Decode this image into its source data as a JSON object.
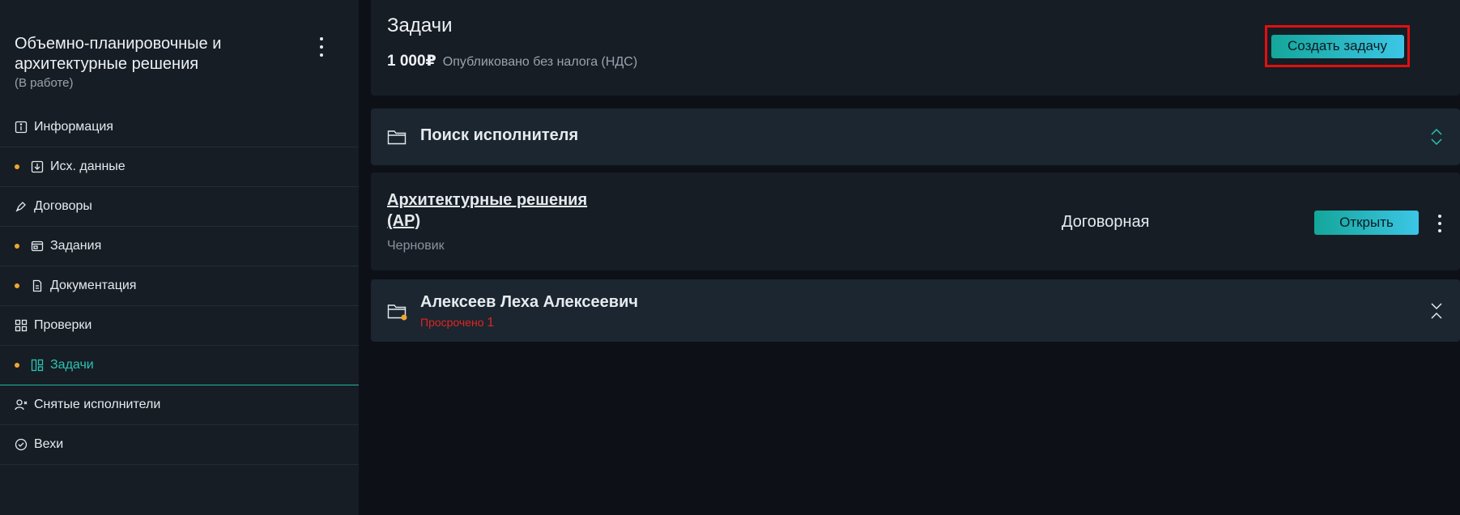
{
  "sidebar": {
    "project_title": "Объемно-планировочные и архитектурные решения",
    "project_status": "(В работе)",
    "items": [
      {
        "label": "Информация",
        "icon": "info-icon",
        "dot": false,
        "active": false
      },
      {
        "label": "Исх. данные",
        "icon": "download-icon",
        "dot": true,
        "active": false
      },
      {
        "label": "Договоры",
        "icon": "pen-icon",
        "dot": false,
        "active": false
      },
      {
        "label": "Задания",
        "icon": "window-icon",
        "dot": true,
        "active": false
      },
      {
        "label": "Документация",
        "icon": "document-icon",
        "dot": true,
        "active": false
      },
      {
        "label": "Проверки",
        "icon": "grid-icon",
        "dot": false,
        "active": false
      },
      {
        "label": "Задачи",
        "icon": "layout-icon",
        "dot": true,
        "active": true
      },
      {
        "label": "Снятые исполнители",
        "icon": "user-remove-icon",
        "dot": false,
        "active": false
      },
      {
        "label": "Вехи",
        "icon": "check-circle-icon",
        "dot": false,
        "active": false
      }
    ]
  },
  "header": {
    "title": "Задачи",
    "price": "1 000₽",
    "price_note": "Опубликовано без налога (НДС)",
    "create_label": "Создать задачу"
  },
  "search_section": {
    "title": "Поиск исполнителя",
    "icon": "folder-icon"
  },
  "task_card": {
    "title": "Архитектурные решения (АР)",
    "status": "Черновик",
    "price": "Договорная",
    "open_label": "Открыть"
  },
  "person_section": {
    "name": "Алексеев Леха Алексеевич",
    "overdue_label": "Просрочено",
    "overdue_count": "1"
  },
  "colors": {
    "accent": "#2cc3b0",
    "dot": "#f0a630",
    "danger": "#e02424",
    "highlight_box": "#e01010"
  }
}
